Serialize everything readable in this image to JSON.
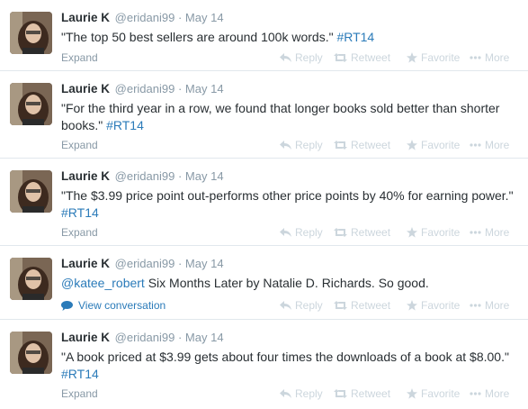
{
  "tweets": [
    {
      "name": "Laurie K",
      "handle": "@eridani99",
      "separator": "·",
      "date": "May 14",
      "text": "\"The top 50 best sellers are around 100k words.\"",
      "tag": "#RT14",
      "mention": "",
      "rest": "",
      "footer": "Expand"
    },
    {
      "name": "Laurie K",
      "handle": "@eridani99",
      "separator": "·",
      "date": "May 14",
      "text": "\"For the third year in a row, we found that longer books sold better than shorter books.\"",
      "tag": "#RT14",
      "mention": "",
      "rest": "",
      "footer": "Expand"
    },
    {
      "name": "Laurie K",
      "handle": "@eridani99",
      "separator": "·",
      "date": "May 14",
      "text": "\"The $3.99 price point out-performs other price points by 40% for earning power.\"",
      "tag": "#RT14",
      "mention": "",
      "rest": "",
      "footer": "Expand"
    },
    {
      "name": "Laurie K",
      "handle": "@eridani99",
      "separator": "·",
      "date": "May 14",
      "text": "",
      "tag": "",
      "mention": "@katee_robert",
      "rest": "Six Months Later by Natalie D. Richards. So good.",
      "footer": "View conversation"
    },
    {
      "name": "Laurie K",
      "handle": "@eridani99",
      "separator": "·",
      "date": "May 14",
      "text": "\"A book priced at $3.99 gets about four times the downloads of a book at $8.00.\"",
      "tag": "#RT14",
      "mention": "",
      "rest": "",
      "footer": "Expand"
    }
  ],
  "actions": {
    "reply": "Reply",
    "retweet": "Retweet",
    "favorite": "Favorite",
    "more": "More"
  },
  "colors": {
    "link": "#2b7bb9",
    "muted": "#8899a6",
    "action": "#ccd6dd"
  }
}
